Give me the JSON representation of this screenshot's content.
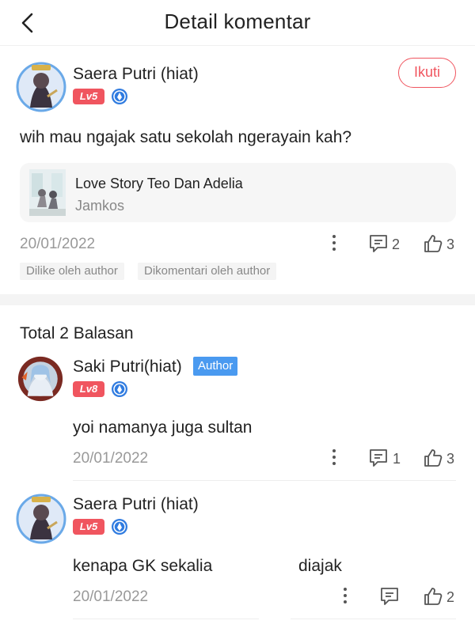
{
  "header": {
    "title": "Detail komentar"
  },
  "main_comment": {
    "user_name": "Saera Putri (hiat)",
    "level": "Lv5",
    "follow_label": "Ikuti",
    "text": "wih mau ngajak satu sekolah ngerayain kah?",
    "book": {
      "title": "Love Story Teo Dan Adelia",
      "author": "Jamkos"
    },
    "date": "20/01/2022",
    "reply_count": "2",
    "like_count": "3",
    "tags": [
      "Dilike oleh author",
      "Dikomentari oleh author"
    ]
  },
  "replies_header": "Total 2 Balasan",
  "replies": [
    {
      "user_name": "Saki Putri(hiat)",
      "author_badge": "Author",
      "level": "Lv8",
      "text": "yoi namanya juga sultan",
      "date": "20/01/2022",
      "reply_count": "1",
      "like_count": "3"
    },
    {
      "user_name": "Saera Putri (hiat)",
      "level": "Lv5",
      "text_part1": "kenapa GK sekalia",
      "text_part2": "diajak",
      "date": "20/01/2022",
      "like_count": "2"
    }
  ],
  "colors": {
    "accent": "#f0555f",
    "author_badge": "#4a9af0",
    "level_badge": "#f0555f",
    "shield": "#2f7be0"
  },
  "icons": [
    "back-arrow-icon",
    "avatar",
    "shield-icon",
    "more-icon",
    "reply-icon",
    "like-icon"
  ]
}
